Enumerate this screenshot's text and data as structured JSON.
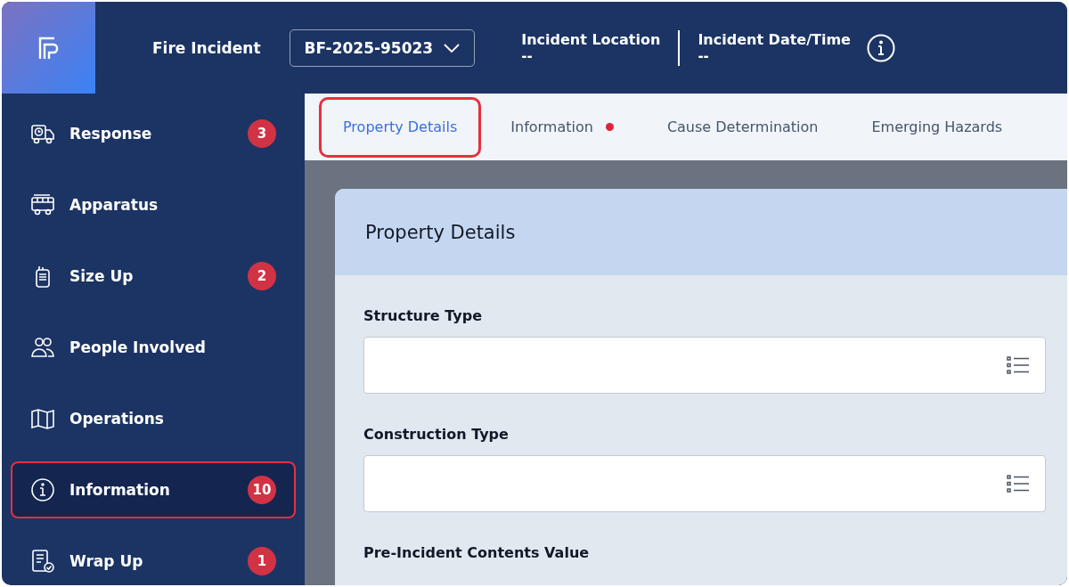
{
  "header": {
    "title": "Fire Incident",
    "incident_select": {
      "value": "BF-2025-95023"
    },
    "fields": [
      {
        "label": "Incident Location",
        "value": "--"
      },
      {
        "label": "Incident Date/Time",
        "value": "--"
      }
    ]
  },
  "sidebar": {
    "items": [
      {
        "label": "Response",
        "badge": "3",
        "selected": false,
        "highlighted": false
      },
      {
        "label": "Apparatus",
        "selected": false,
        "highlighted": false
      },
      {
        "label": "Size Up",
        "badge": "2",
        "selected": false,
        "highlighted": false
      },
      {
        "label": "People Involved",
        "selected": false,
        "highlighted": false
      },
      {
        "label": "Operations",
        "selected": false,
        "highlighted": false
      },
      {
        "label": "Information",
        "badge": "10",
        "selected": true,
        "highlighted": true
      },
      {
        "label": "Wrap Up",
        "badge": "1",
        "selected": false,
        "highlighted": false
      }
    ]
  },
  "tabs": [
    {
      "label": "Property Details",
      "selected": true,
      "highlighted": true,
      "dot": false
    },
    {
      "label": "Information",
      "selected": false,
      "highlighted": false,
      "dot": true
    },
    {
      "label": "Cause Determination",
      "selected": false,
      "highlighted": false,
      "dot": false
    },
    {
      "label": "Emerging Hazards",
      "selected": false,
      "highlighted": false,
      "dot": false
    }
  ],
  "card": {
    "title": "Property Details",
    "fields": [
      {
        "label": "Structure Type",
        "kind": "list"
      },
      {
        "label": "Construction Type",
        "kind": "list"
      },
      {
        "label": "Pre-Incident Contents Value",
        "kind": "label"
      }
    ]
  }
}
